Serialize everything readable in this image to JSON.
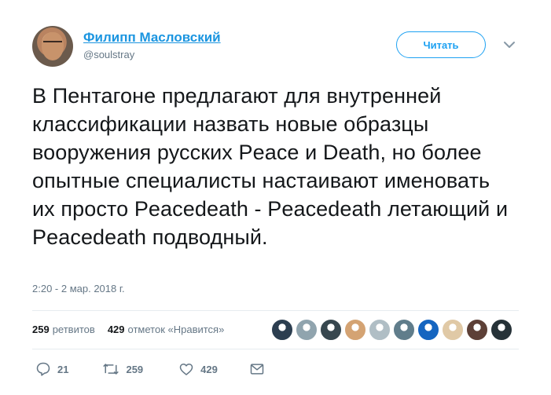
{
  "author": {
    "display_name": "Филипп Масловский",
    "handle": "@soulstray"
  },
  "header": {
    "follow_label": "Читать"
  },
  "tweet": {
    "text": "В Пентагоне предлагают для внутренней классификации назвать новые образцы вооружения русских Peace и Death, но более опытные специалисты настаивают именовать их просто Peacedeath - Peacedeath летающий и Peacedeath подводный.",
    "timestamp": "2:20 - 2 мар. 2018 г."
  },
  "stats": {
    "retweets_count": "259",
    "retweets_label": "ретвитов",
    "likes_count": "429",
    "likes_label": "отметок «Нравится»"
  },
  "actions": {
    "reply_count": "21",
    "retweet_count": "259",
    "like_count": "429"
  },
  "icons": {
    "reply": "reply-icon",
    "retweet": "retweet-icon",
    "like": "heart-icon",
    "message": "envelope-icon",
    "caret": "chevron-down-icon"
  },
  "colors": {
    "link": "#1b95e0",
    "accent": "#1da1f2",
    "muted": "#657786",
    "text": "#14171a",
    "divider": "#e6ecf0"
  },
  "liker_colors": [
    "#2c3e50",
    "#90a4ae",
    "#37474f",
    "#d4a373",
    "#b0bec5",
    "#607d8b",
    "#1565c0",
    "#e0c9a6",
    "#5d4037",
    "#263238"
  ]
}
